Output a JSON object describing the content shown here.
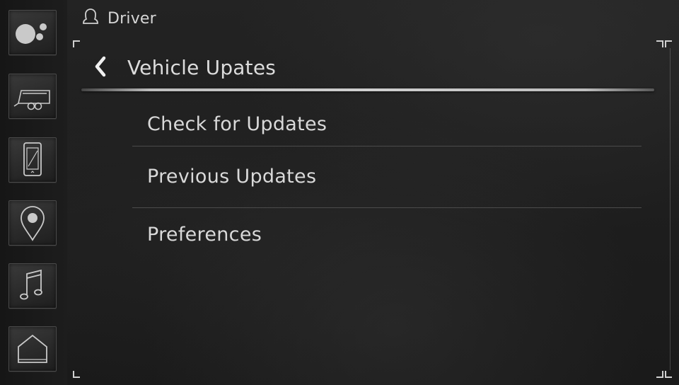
{
  "header": {
    "profile_label": "Driver",
    "profile_icon": "person-silhouette-icon"
  },
  "sidebar": {
    "items": [
      {
        "id": "apps",
        "icon": "apps-bubbles-icon"
      },
      {
        "id": "trailer",
        "icon": "trailer-icon"
      },
      {
        "id": "phone",
        "icon": "phone-icon"
      },
      {
        "id": "navigation",
        "icon": "map-pin-icon"
      },
      {
        "id": "media",
        "icon": "music-note-icon"
      },
      {
        "id": "home",
        "icon": "home-icon"
      }
    ]
  },
  "page": {
    "title": "Vehicle Upates",
    "back_icon": "chevron-left-icon"
  },
  "menu": {
    "items": [
      {
        "label": "Check for Updates"
      },
      {
        "label": "Previous Updates"
      },
      {
        "label": "Preferences"
      }
    ]
  },
  "colors": {
    "background": "#1e1e1e",
    "text": "#d9d9d9",
    "accent_line": "#cfcfcf"
  }
}
